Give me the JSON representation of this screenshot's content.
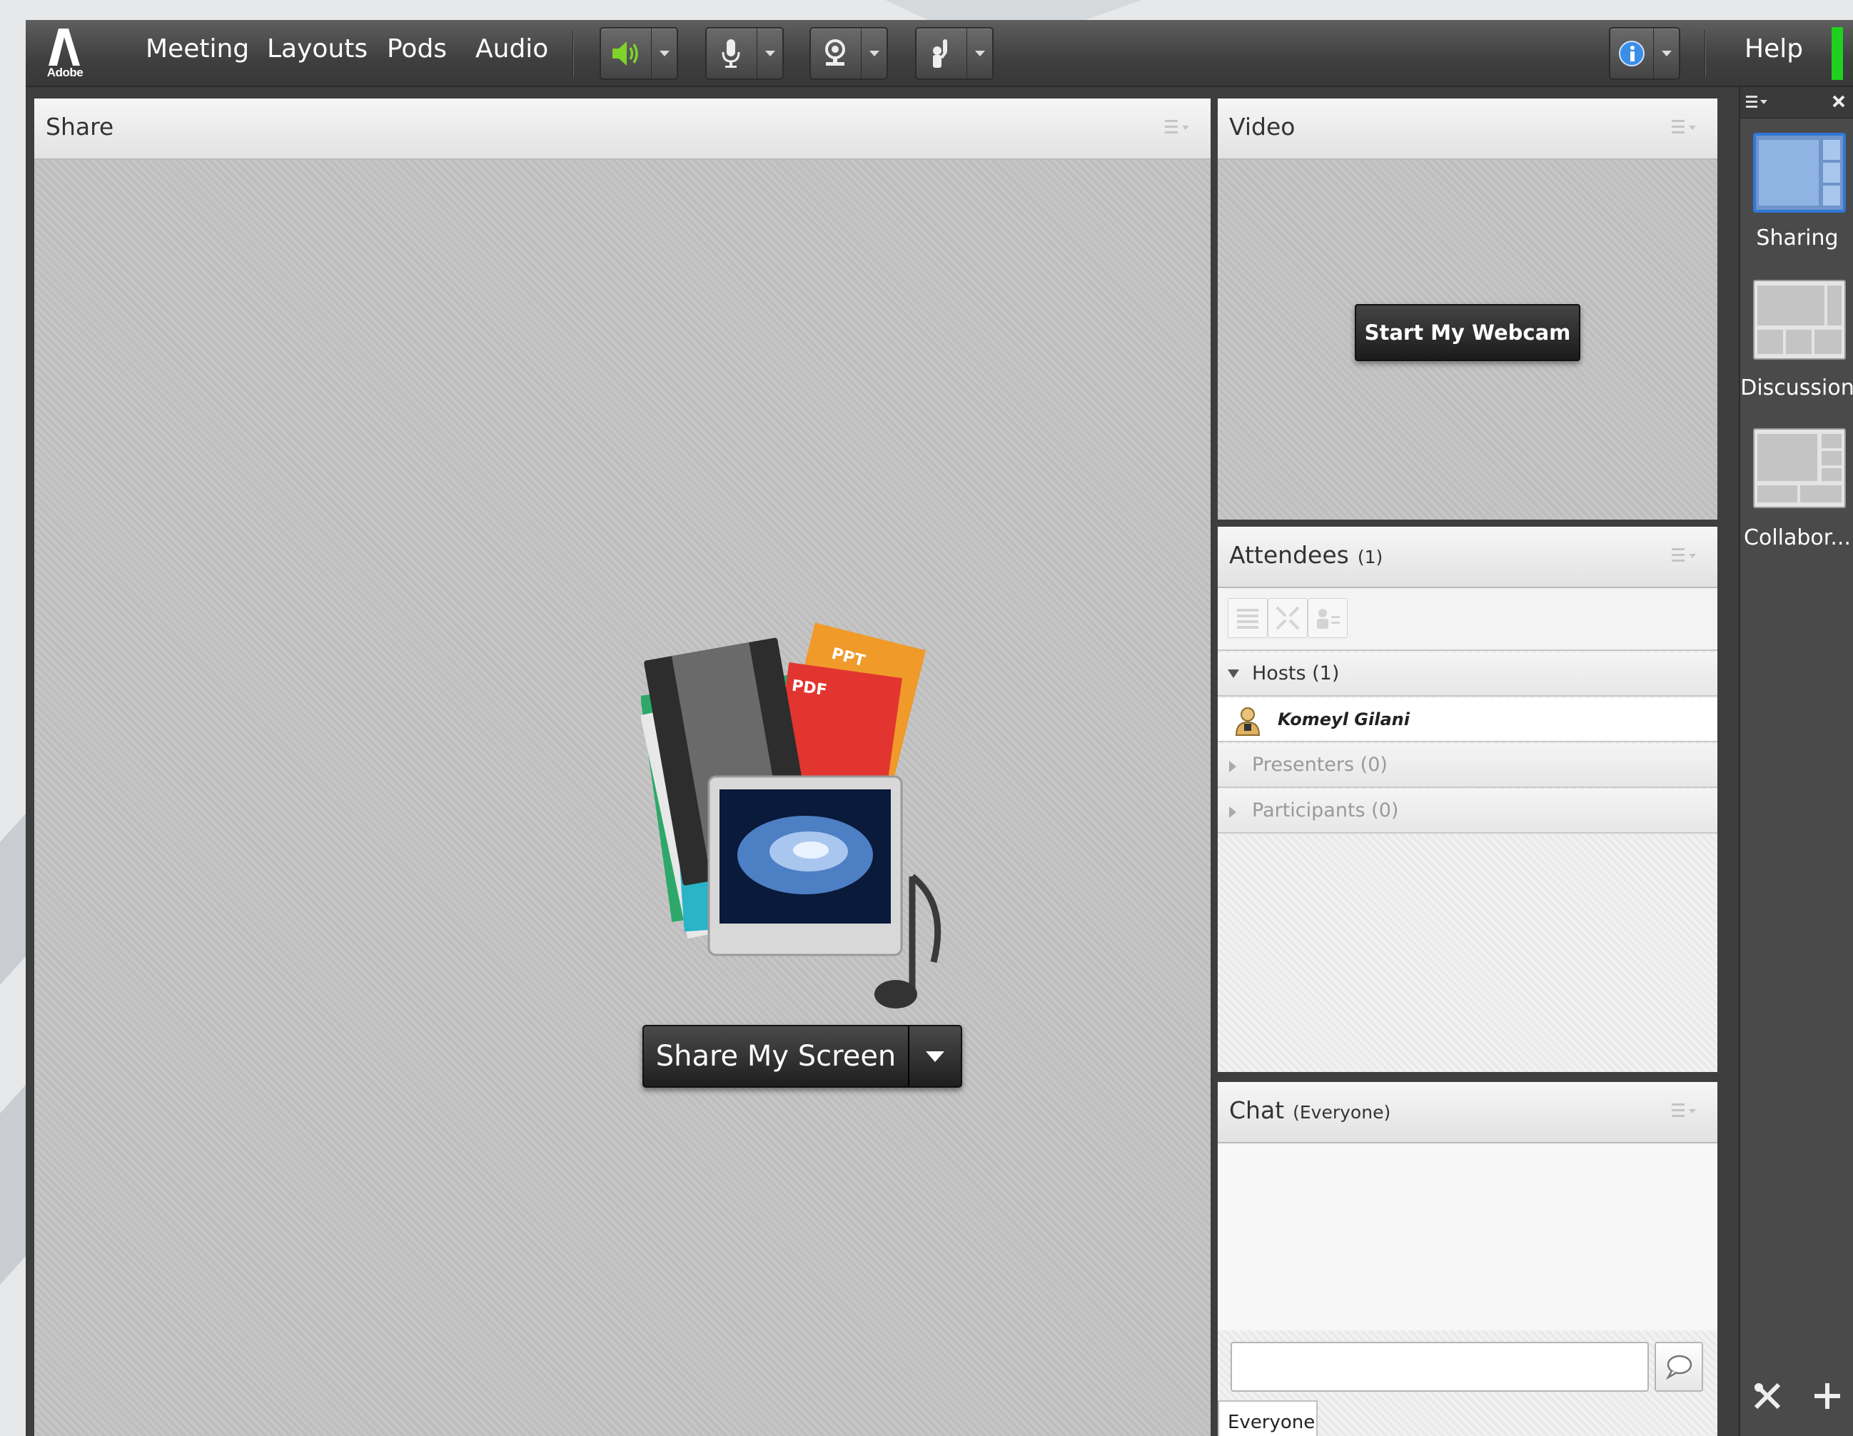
{
  "app": {
    "logo_text": "Adobe",
    "menu": [
      "Meeting",
      "Layouts",
      "Pods",
      "Audio"
    ],
    "help_label": "Help",
    "colors": {
      "accent": "#2f78d6",
      "status_green": "#1fd11f",
      "speaker_green": "#7fd32a"
    }
  },
  "toolbar_icons": [
    "speaker-icon",
    "microphone-icon",
    "webcam-icon",
    "raise-hand-icon",
    "info-icon"
  ],
  "share_pod": {
    "title": "Share",
    "share_button": "Share My Screen",
    "illustration_tags": [
      "PPT",
      "PDF"
    ]
  },
  "video_pod": {
    "title": "Video",
    "webcam_button": "Start My Webcam"
  },
  "attendees_pod": {
    "title": "Attendees",
    "count": "(1)",
    "groups": [
      {
        "label": "Hosts (1)",
        "expanded": true,
        "members": [
          "Komeyl Gilani"
        ]
      },
      {
        "label": "Presenters (0)",
        "expanded": false,
        "members": []
      },
      {
        "label": "Participants (0)",
        "expanded": false,
        "members": []
      }
    ]
  },
  "chat_pod": {
    "title": "Chat",
    "subtitle": "(Everyone)",
    "input_value": "",
    "tab": "Everyone"
  },
  "layouts": [
    {
      "label": "Sharing",
      "selected": true
    },
    {
      "label": "Discussion",
      "selected": false
    },
    {
      "label": "Collabor...",
      "selected": false
    }
  ]
}
